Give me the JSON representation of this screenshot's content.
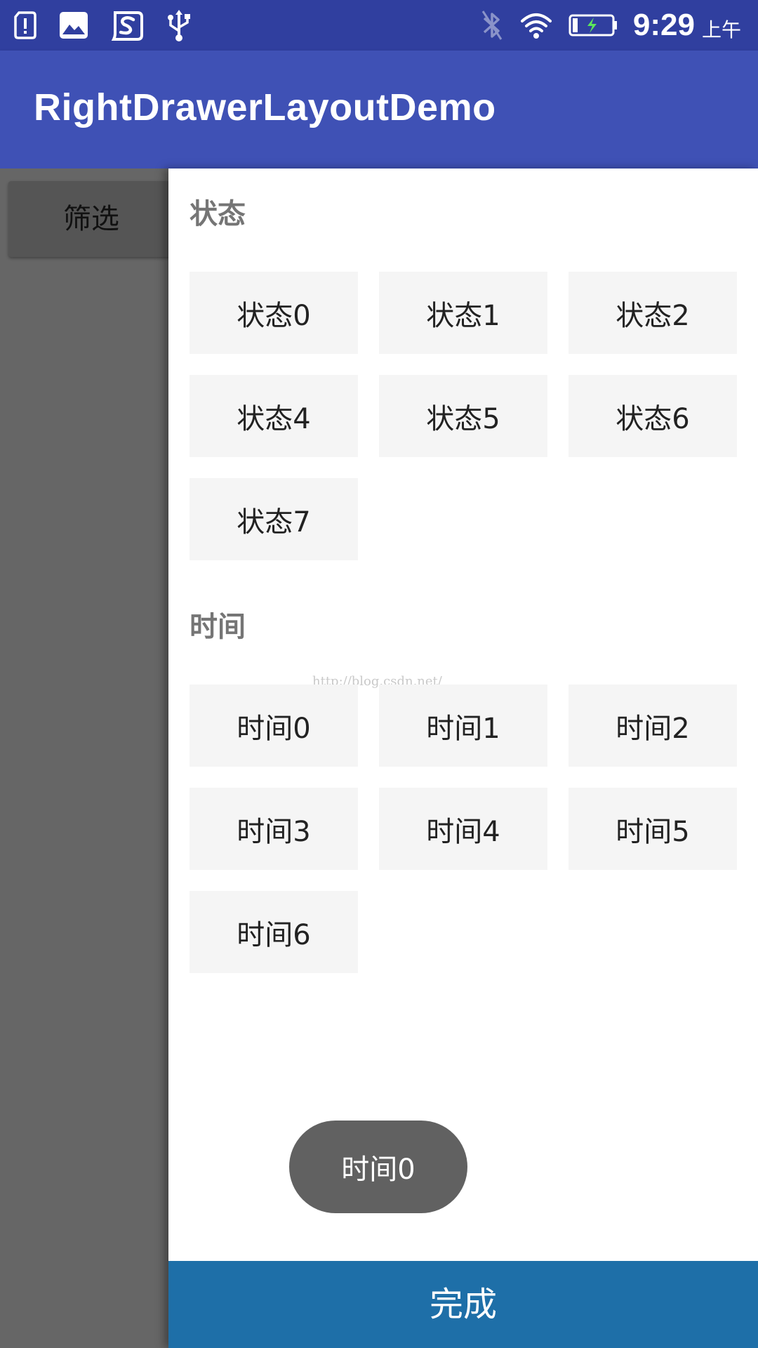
{
  "status_bar": {
    "time": "9:29",
    "ampm": "上午",
    "icons": [
      "alert-icon",
      "image-icon",
      "sogou-icon",
      "usb-icon",
      "bluetooth-off-icon",
      "wifi-icon",
      "battery-charging-icon"
    ]
  },
  "app_bar": {
    "title": "RightDrawerLayoutDemo"
  },
  "main": {
    "filter_label": "筛选"
  },
  "drawer": {
    "status_section": {
      "title": "状态",
      "items": [
        "状态0",
        "状态1",
        "状态2",
        "状态4",
        "状态5",
        "状态6",
        "状态7"
      ]
    },
    "time_section": {
      "title": "时间",
      "items": [
        "时间0",
        "时间1",
        "时间2",
        "时间3",
        "时间4",
        "时间5",
        "时间6"
      ]
    },
    "watermark": "http://blog.csdn.net/",
    "toast": "时间0",
    "done_label": "完成"
  },
  "colors": {
    "status_bar": "#303f9f",
    "app_bar": "#3f51b5",
    "done_button": "#1e6fa8",
    "chip_bg": "#f5f5f5",
    "scrim": "#666666"
  }
}
